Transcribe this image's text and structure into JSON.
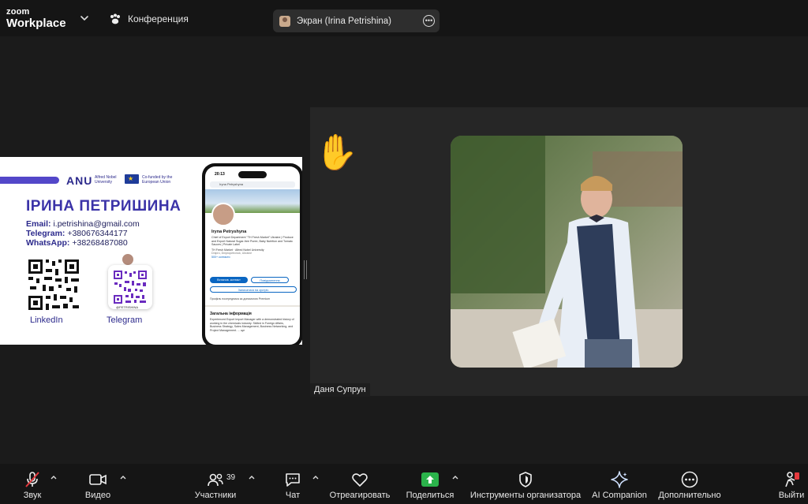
{
  "app": {
    "brand_line1": "zoom",
    "brand_line2": "Workplace",
    "conference_label": "Конференция"
  },
  "share_indicator": {
    "label": "Экран (Irina Petrishina)"
  },
  "shared_slide": {
    "logo": "ANU",
    "logo_sub": "Alfred Nobel University",
    "eu_text": "Co-funded by the European Union",
    "name": "ІРИНА ПЕТРИШИНА",
    "email_label": "Email:",
    "email": "i.petrishina@gmail.com",
    "telegram_label": "Telegram:",
    "telegram": "+380676344177",
    "whatsapp_label": "WhatsApp:",
    "whatsapp": "+38268487080",
    "qr_linkedin_label": "LinkedIn",
    "qr_telegram_label": "Telegram",
    "telegram_handle": "@PETRISHINA",
    "phone": {
      "time": "20:13",
      "search": "Iryna Petryshyna",
      "profile_name": "Iryna Petryshyna",
      "profile_desc": "Chief of Export Department \"TH Fresh Market\" Ukraine | Produce and Export Natural Sugar-free Puree, Baby Nutrition and Tomato Sauces | Private Label",
      "company": "TH Fresh Market · Alfred Nobel University",
      "location": "Dnipro, Dnipropetrovsk, Ukraine",
      "contacts": "500+ контакти",
      "btn_contact": "Встанов. контакт",
      "btn_follow": "Повідомлення",
      "btn_meet": "Записатися на зустріч",
      "premium": "Профіль посередника за допомогою Premium",
      "section_title": "Загальна інформація",
      "section_text": "Experienced Export Import Manager with a demonstrated history of working in the chemicals industry. Skilled in Foreign Affairs, Business Strategy, Sales Management, Business Networking, and Project Management. ... ще"
    }
  },
  "participant": {
    "name": "Даня Супрун",
    "reaction": "✋"
  },
  "toolbar": {
    "audio_label": "Звук",
    "video_label": "Видео",
    "participants_label": "Участники",
    "participants_count": "39",
    "chat_label": "Чат",
    "react_label": "Отреагировать",
    "share_label": "Поделиться",
    "host_tools_label": "Инструменты организатора",
    "ai_label": "AI Companion",
    "more_label": "Дополнительно",
    "leave_label": "Выйти"
  },
  "colors": {
    "share_green": "#2bb34b",
    "mute_red": "#e5393e",
    "slide_accent": "#3b33a8"
  }
}
